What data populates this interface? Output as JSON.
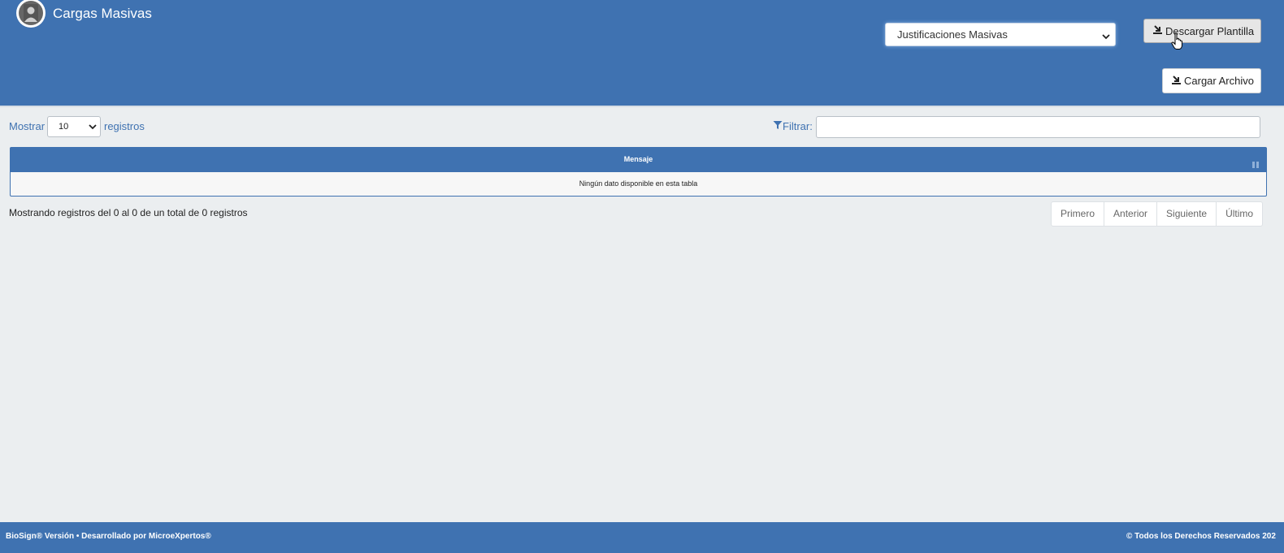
{
  "header": {
    "title": "Cargas Masivas",
    "load_type_selected": "Justificaciones Masivas",
    "download_template_label": "Descargar Plantilla",
    "upload_file_label": "Cargar Archivo"
  },
  "controls": {
    "show_label": "Mostrar",
    "page_length_selected": "10",
    "records_label": "registros",
    "filter_label": "Filtrar:",
    "filter_value": ""
  },
  "table": {
    "columns": [
      "Mensaje"
    ],
    "empty_message": "Ningún dato disponible en esta tabla"
  },
  "info": {
    "summary": "Mostrando registros del 0 al 0 de un total de 0 registros"
  },
  "pagination": {
    "first": "Primero",
    "previous": "Anterior",
    "next": "Siguiente",
    "last": "Último"
  },
  "footer": {
    "left": "BioSign® Versión • Desarrollado por MicroeXpertos®",
    "right": "© Todos los Derechos Reservados 202"
  },
  "colors": {
    "primary": "#3f72b1",
    "background": "#ebeef0"
  },
  "icons": [
    "user-avatar-icon",
    "chevron-down-icon",
    "download-icon",
    "upload-icon",
    "filter-icon",
    "sort-icon",
    "hand-cursor-icon"
  ]
}
